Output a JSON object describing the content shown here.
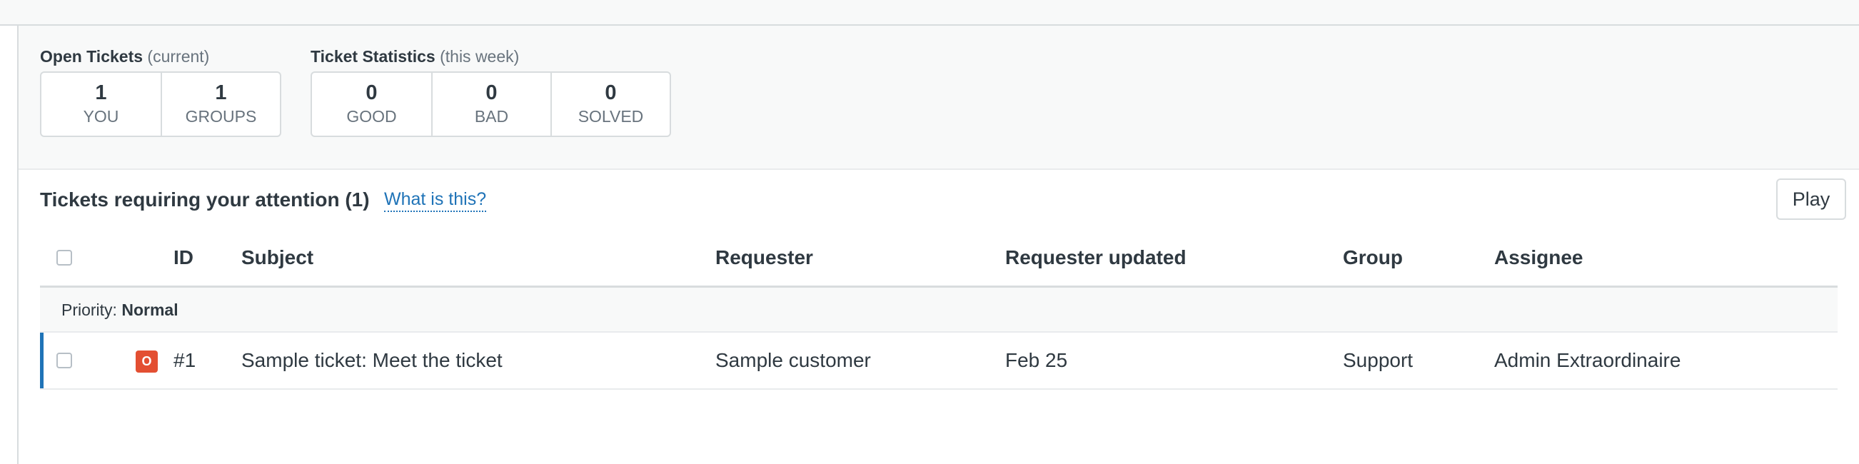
{
  "stats": {
    "open_tickets": {
      "title": "Open Tickets",
      "qualifier": "(current)",
      "boxes": [
        {
          "value": "1",
          "label": "YOU"
        },
        {
          "value": "1",
          "label": "GROUPS"
        }
      ]
    },
    "ticket_statistics": {
      "title": "Ticket Statistics",
      "qualifier": "(this week)",
      "boxes": [
        {
          "value": "0",
          "label": "GOOD"
        },
        {
          "value": "0",
          "label": "BAD"
        },
        {
          "value": "0",
          "label": "SOLVED"
        }
      ]
    }
  },
  "view": {
    "title": "Tickets requiring your attention (1)",
    "help_link": "What is this?",
    "play_label": "Play"
  },
  "table": {
    "columns": {
      "id": "ID",
      "subject": "Subject",
      "requester": "Requester",
      "requester_updated": "Requester updated",
      "group": "Group",
      "assignee": "Assignee"
    },
    "group_row": {
      "prefix": "Priority:",
      "value": "Normal"
    },
    "rows": [
      {
        "status_letter": "O",
        "status_color": "#e34f32",
        "id": "#1",
        "subject": "Sample ticket: Meet the ticket",
        "requester": "Sample customer",
        "requester_updated": "Feb 25",
        "group": "Support",
        "assignee": "Admin Extraordinaire"
      }
    ]
  },
  "colors": {
    "accent": "#1f73b7",
    "status_open": "#e34f32",
    "panel_bg": "#f8f9f9",
    "border": "#d8dcde"
  }
}
